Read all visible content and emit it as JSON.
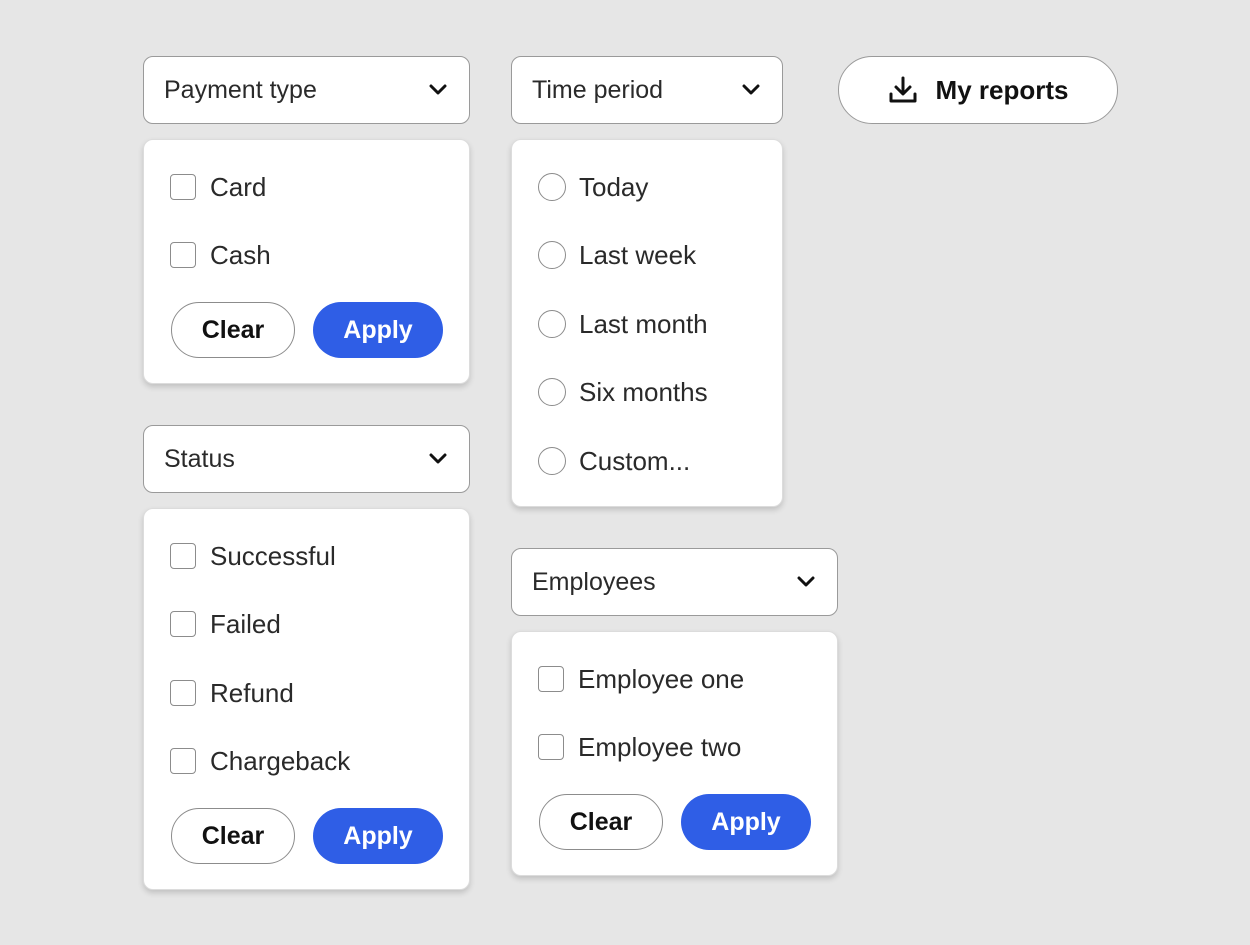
{
  "payment": {
    "label": "Payment type",
    "options": [
      "Card",
      "Cash"
    ],
    "clear_label": "Clear",
    "apply_label": "Apply"
  },
  "time_period": {
    "label": "Time period",
    "options": [
      "Today",
      "Last week",
      "Last month",
      "Six months",
      "Custom..."
    ]
  },
  "reports": {
    "label": "My reports",
    "icon": "download-icon"
  },
  "status": {
    "label": "Status",
    "options": [
      "Successful",
      "Failed",
      "Refund",
      "Chargeback"
    ],
    "clear_label": "Clear",
    "apply_label": "Apply"
  },
  "employees": {
    "label": "Employees",
    "options": [
      "Employee one",
      "Employee two"
    ],
    "clear_label": "Clear",
    "apply_label": "Apply"
  },
  "colors": {
    "background": "#e6e6e6",
    "apply_button": "#2f5ee6",
    "border": "#9a9a9a"
  }
}
